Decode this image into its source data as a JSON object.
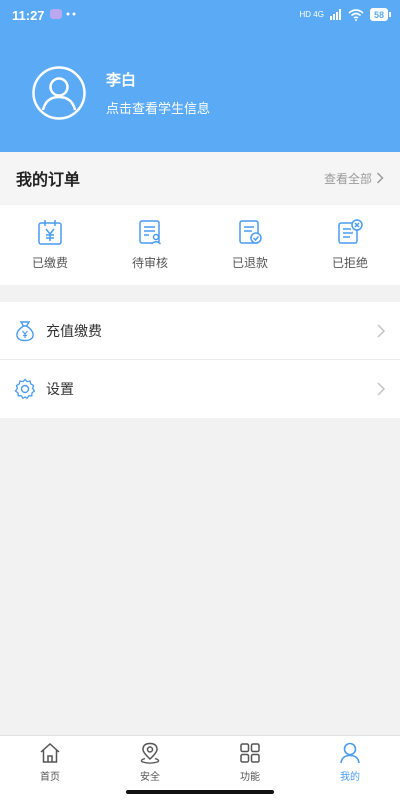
{
  "status_bar": {
    "time": "11:27",
    "network": "HD 4G",
    "battery": "58"
  },
  "profile": {
    "name": "李白",
    "subtitle": "点击查看学生信息"
  },
  "orders": {
    "title": "我的订单",
    "view_all": "查看全部",
    "items": [
      {
        "label": "已缴费",
        "icon": "paid-yen-bag-icon"
      },
      {
        "label": "待审核",
        "icon": "pending-review-doc-icon"
      },
      {
        "label": "已退款",
        "icon": "refunded-doc-check-icon"
      },
      {
        "label": "已拒绝",
        "icon": "rejected-doc-x-icon"
      }
    ]
  },
  "menu": [
    {
      "label": "充值缴费",
      "icon": "money-bag-icon"
    },
    {
      "label": "设置",
      "icon": "gear-icon"
    }
  ],
  "tabbar": [
    {
      "label": "首页",
      "icon": "home-icon",
      "active": false
    },
    {
      "label": "安全",
      "icon": "location-pin-icon",
      "active": false
    },
    {
      "label": "功能",
      "icon": "grid-icon",
      "active": false
    },
    {
      "label": "我的",
      "icon": "user-icon",
      "active": true
    }
  ],
  "colors": {
    "brand": "#5aaaf6",
    "icon_blue": "#4a9cf0",
    "icon_gray": "#666666"
  }
}
